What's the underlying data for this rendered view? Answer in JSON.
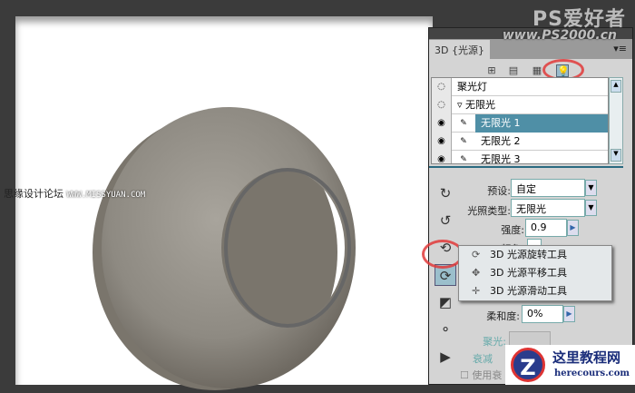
{
  "watermarks": {
    "top_logo": "PS爱好者",
    "top_url": "www.PS2000.cn",
    "left_cn": "思缘设计论坛",
    "left_url": "WWW.MISSYUAN.COM",
    "brand_cn": "这里教程网",
    "brand_url": "herecours.com"
  },
  "panel": {
    "title": "3D {光源}",
    "menu_icon": "panel-menu-icon",
    "filters": [
      "scene-icon",
      "mesh-icon",
      "material-icon",
      "light-icon"
    ],
    "lights": [
      {
        "label": "聚光灯",
        "type": "group",
        "visible": false
      },
      {
        "label": "无限光",
        "type": "group",
        "visible": false
      },
      {
        "label": "无限光 1",
        "type": "item",
        "visible": true,
        "selected": true
      },
      {
        "label": "无限光 2",
        "type": "item",
        "visible": true,
        "selected": false
      },
      {
        "label": "无限光 3",
        "type": "item",
        "visible": true,
        "selected": false
      }
    ],
    "preset_label": "预设:",
    "preset_value": "自定",
    "light_type_label": "光照类型:",
    "light_type_value": "无限光",
    "intensity_label": "强度:",
    "intensity_value": "0.9",
    "color_label": "颜色:",
    "softness_label": "柔和度:",
    "softness_value": "0%",
    "hotspot_label": "聚光:",
    "falloff_label": "衰减",
    "use_label": "使用衰"
  },
  "flyout": {
    "items": [
      "3D 光源旋转工具",
      "3D 光源平移工具",
      "3D 光源滑动工具"
    ]
  },
  "colors": {
    "selection": "#4f8fa6",
    "highlight": "#e03a3a"
  }
}
